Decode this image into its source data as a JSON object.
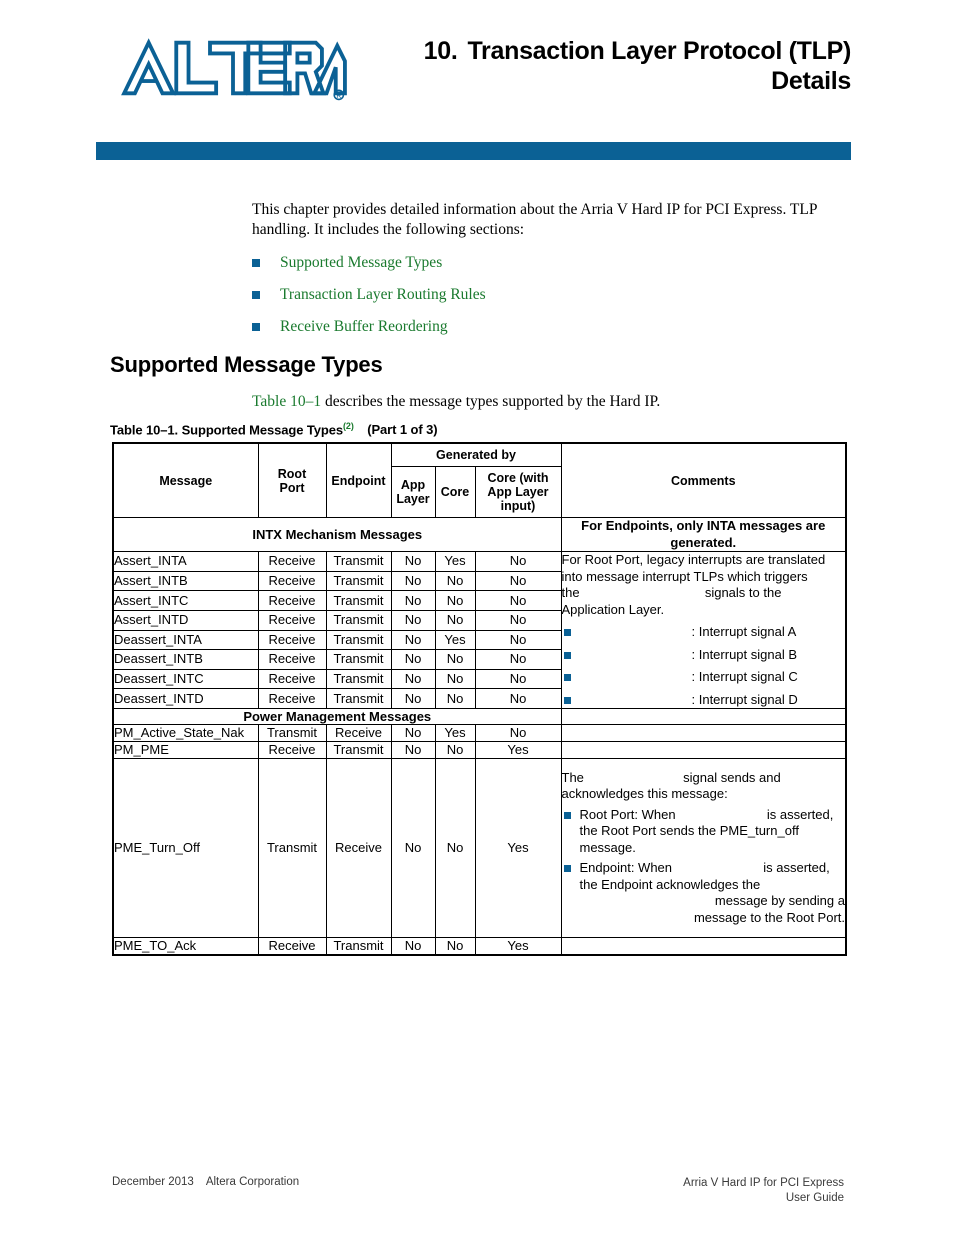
{
  "header": {
    "logo_text": "ALTERA",
    "logo_mark": "®",
    "chapter_number": "10.",
    "chapter_title_line1": "Transaction Layer Protocol (TLP)",
    "chapter_title_line2": "Details",
    "bar_color": "#0b6195"
  },
  "intro": {
    "paragraph": "This chapter provides detailed information about the Arria  V Hard IP for PCI Express. TLP handling. It includes the following sections:",
    "links": [
      {
        "label": "Supported Message Types"
      },
      {
        "label": "Transaction Layer Routing Rules"
      },
      {
        "label": "Receive Buffer Reordering"
      }
    ],
    "link_color": "#1a7a2e",
    "bullet_color": "#0b6195"
  },
  "section": {
    "heading": "Supported Message Types",
    "lead_link": "Table 10–1",
    "lead_rest": " describes the message types supported by the Hard IP."
  },
  "table_caption": {
    "number": "Table 10–1.",
    "title": "Supported Message Types",
    "footnote_marker": "(2)",
    "part": "(Part 1 of 3)"
  },
  "table": {
    "headers": {
      "message": "Message",
      "root_port": "Root\nPort",
      "root_port_l1": "Root",
      "root_port_l2": "Port",
      "endpoint": "Endpoint",
      "generated_by": "Generated by",
      "app_layer_l1": "App",
      "app_layer_l2": "Layer",
      "core": "Core",
      "core_app_l1": "Core (with",
      "core_app_l2": "App Layer",
      "core_app_l3": "input)",
      "comments": "Comments"
    },
    "sections": [
      {
        "section_title": "INTX Mechanism Messages",
        "section_comment": "For Endpoints, only INTA messages are generated.",
        "rows": [
          {
            "message": "Assert_INTA",
            "root_port": "Receive",
            "endpoint": "Transmit",
            "app_layer": "No",
            "core": "Yes",
            "core_app": "No"
          },
          {
            "message": "Assert_INTB",
            "root_port": "Receive",
            "endpoint": "Transmit",
            "app_layer": "No",
            "core": "No",
            "core_app": "No"
          },
          {
            "message": "Assert_INTC",
            "root_port": "Receive",
            "endpoint": "Transmit",
            "app_layer": "No",
            "core": "No",
            "core_app": "No"
          },
          {
            "message": "Assert_INTD",
            "root_port": "Receive",
            "endpoint": "Transmit",
            "app_layer": "No",
            "core": "No",
            "core_app": "No"
          },
          {
            "message": "Deassert_INTA",
            "root_port": "Receive",
            "endpoint": "Transmit",
            "app_layer": "No",
            "core": "Yes",
            "core_app": "No"
          },
          {
            "message": "Deassert_INTB",
            "root_port": "Receive",
            "endpoint": "Transmit",
            "app_layer": "No",
            "core": "No",
            "core_app": "No"
          },
          {
            "message": "Deassert_INTC",
            "root_port": "Receive",
            "endpoint": "Transmit",
            "app_layer": "No",
            "core": "No",
            "core_app": "No"
          },
          {
            "message": "Deassert_INTD",
            "root_port": "Receive",
            "endpoint": "Transmit",
            "app_layer": "No",
            "core": "No",
            "core_app": "No"
          }
        ],
        "intx_comment": {
          "line1": "For Root Port, legacy interrupts are translated",
          "line2": "into message interrupt TLPs which triggers",
          "line3_pre": "the",
          "line3_post": "signals to the",
          "line4": "Application Layer.",
          "bullets": [
            {
              "suffix": ": Interrupt signal A"
            },
            {
              "suffix": ": Interrupt signal B"
            },
            {
              "suffix": ": Interrupt signal C"
            },
            {
              "suffix": ": Interrupt signal D"
            }
          ]
        }
      },
      {
        "section_title": "Power Management Messages",
        "section_comment": "",
        "rows": [
          {
            "message": "PM_Active_State_Nak",
            "root_port": "Transmit",
            "endpoint": "Receive",
            "app_layer": "No",
            "core": "Yes",
            "core_app": "No"
          },
          {
            "message": "PM_PME",
            "root_port": "Receive",
            "endpoint": "Transmit",
            "app_layer": "No",
            "core": "No",
            "core_app": "Yes"
          },
          {
            "message": "PME_Turn_Off",
            "root_port": "Transmit",
            "endpoint": "Receive",
            "app_layer": "No",
            "core": "No",
            "core_app": "Yes"
          },
          {
            "message": "PME_TO_Ack",
            "root_port": "Receive",
            "endpoint": "Transmit",
            "app_layer": "No",
            "core": "No",
            "core_app": "Yes"
          }
        ],
        "pme_comment": {
          "line1_pre": "The",
          "line1_post": "signal sends and",
          "line2": "acknowledges this message:",
          "bullets": [
            {
              "pre": "Root Port: When",
              "post": "is asserted,",
              "cont1": "the Root Port sends the PME_turn_off",
              "cont2": "message."
            },
            {
              "pre": "Endpoint: When",
              "post": "is asserted,",
              "cont1": "the Endpoint acknowledges the",
              "cont2": "message by sending a",
              "cont3": "message to the Root Port."
            }
          ]
        }
      }
    ]
  },
  "footer": {
    "date": "December 2013",
    "corporation": "Altera Corporation",
    "doc_line1": "Arria V Hard IP for PCI Express",
    "doc_line2": "User Guide"
  }
}
